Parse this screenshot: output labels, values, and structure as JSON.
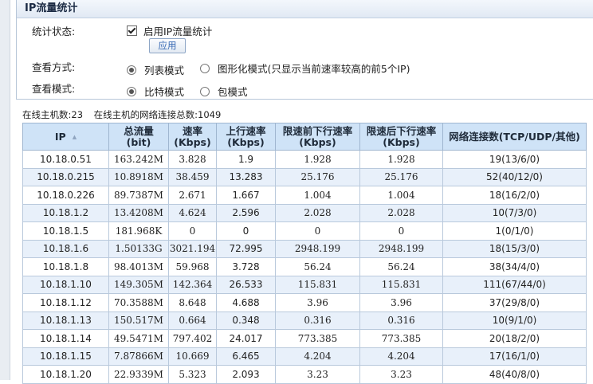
{
  "panel": {
    "title": "IP流量统计",
    "status_label": "统计状态:",
    "enable_label": "启用IP流量统计",
    "apply_label": "应用",
    "view_mode_label": "查看方式:",
    "view_mode_options": [
      "列表模式",
      "图形化模式(只显示当前速率较高的前5个IP)"
    ],
    "view_mode_selected": "列表模式",
    "view_mode2_label": "查看模式:",
    "view_mode2_options": [
      "比特模式",
      "包模式"
    ],
    "view_mode2_selected": "比特模式"
  },
  "summary": {
    "online_hosts": "在线主机数:23",
    "connections": "在线主机的网络连接总数:1049"
  },
  "table": {
    "headers": [
      {
        "line1": "IP",
        "line2": ""
      },
      {
        "line1": "总流量",
        "line2": "(bit)"
      },
      {
        "line1": "速率",
        "line2": "(Kbps)"
      },
      {
        "line1": "上行速率",
        "line2": "(Kbps)"
      },
      {
        "line1": "限速前下行速率",
        "line2": "(Kbps)"
      },
      {
        "line1": "限速后下行速率",
        "line2": "(Kbps)"
      },
      {
        "line1": "网络连接数(TCP/UDP/其他)",
        "line2": ""
      }
    ],
    "rows": [
      [
        "10.18.0.51",
        "163.242M",
        "3.828",
        "1.9",
        "1.928",
        "1.928",
        "19(13/6/0)"
      ],
      [
        "10.18.0.215",
        "10.8918M",
        "38.459",
        "13.283",
        "25.176",
        "25.176",
        "52(40/12/0)"
      ],
      [
        "10.18.0.226",
        "89.7387M",
        "2.671",
        "1.667",
        "1.004",
        "1.004",
        "18(16/2/0)"
      ],
      [
        "10.18.1.2",
        "13.4208M",
        "4.624",
        "2.596",
        "2.028",
        "2.028",
        "10(7/3/0)"
      ],
      [
        "10.18.1.5",
        "181.968K",
        "0",
        "0",
        "0",
        "0",
        "1(0/1/0)"
      ],
      [
        "10.18.1.6",
        "1.50133G",
        "3021.194",
        "72.995",
        "2948.199",
        "2948.199",
        "18(15/3/0)"
      ],
      [
        "10.18.1.8",
        "98.4013M",
        "59.968",
        "3.728",
        "56.24",
        "56.24",
        "38(34/4/0)"
      ],
      [
        "10.18.1.10",
        "149.305M",
        "142.364",
        "26.533",
        "115.831",
        "115.831",
        "111(67/44/0)"
      ],
      [
        "10.18.1.12",
        "70.3588M",
        "8.648",
        "4.688",
        "3.96",
        "3.96",
        "37(29/8/0)"
      ],
      [
        "10.18.1.13",
        "150.517M",
        "0.664",
        "0.348",
        "0.316",
        "0.316",
        "10(9/1/0)"
      ],
      [
        "10.18.1.14",
        "49.5471M",
        "797.402",
        "24.017",
        "773.385",
        "773.385",
        "20(18/2/0)"
      ],
      [
        "10.18.1.15",
        "7.87866M",
        "10.669",
        "6.465",
        "4.204",
        "4.204",
        "17(16/1/0)"
      ],
      [
        "10.18.1.20",
        "22.9339M",
        "5.323",
        "2.093",
        "3.23",
        "3.23",
        "48(40/8/0)"
      ]
    ]
  }
}
